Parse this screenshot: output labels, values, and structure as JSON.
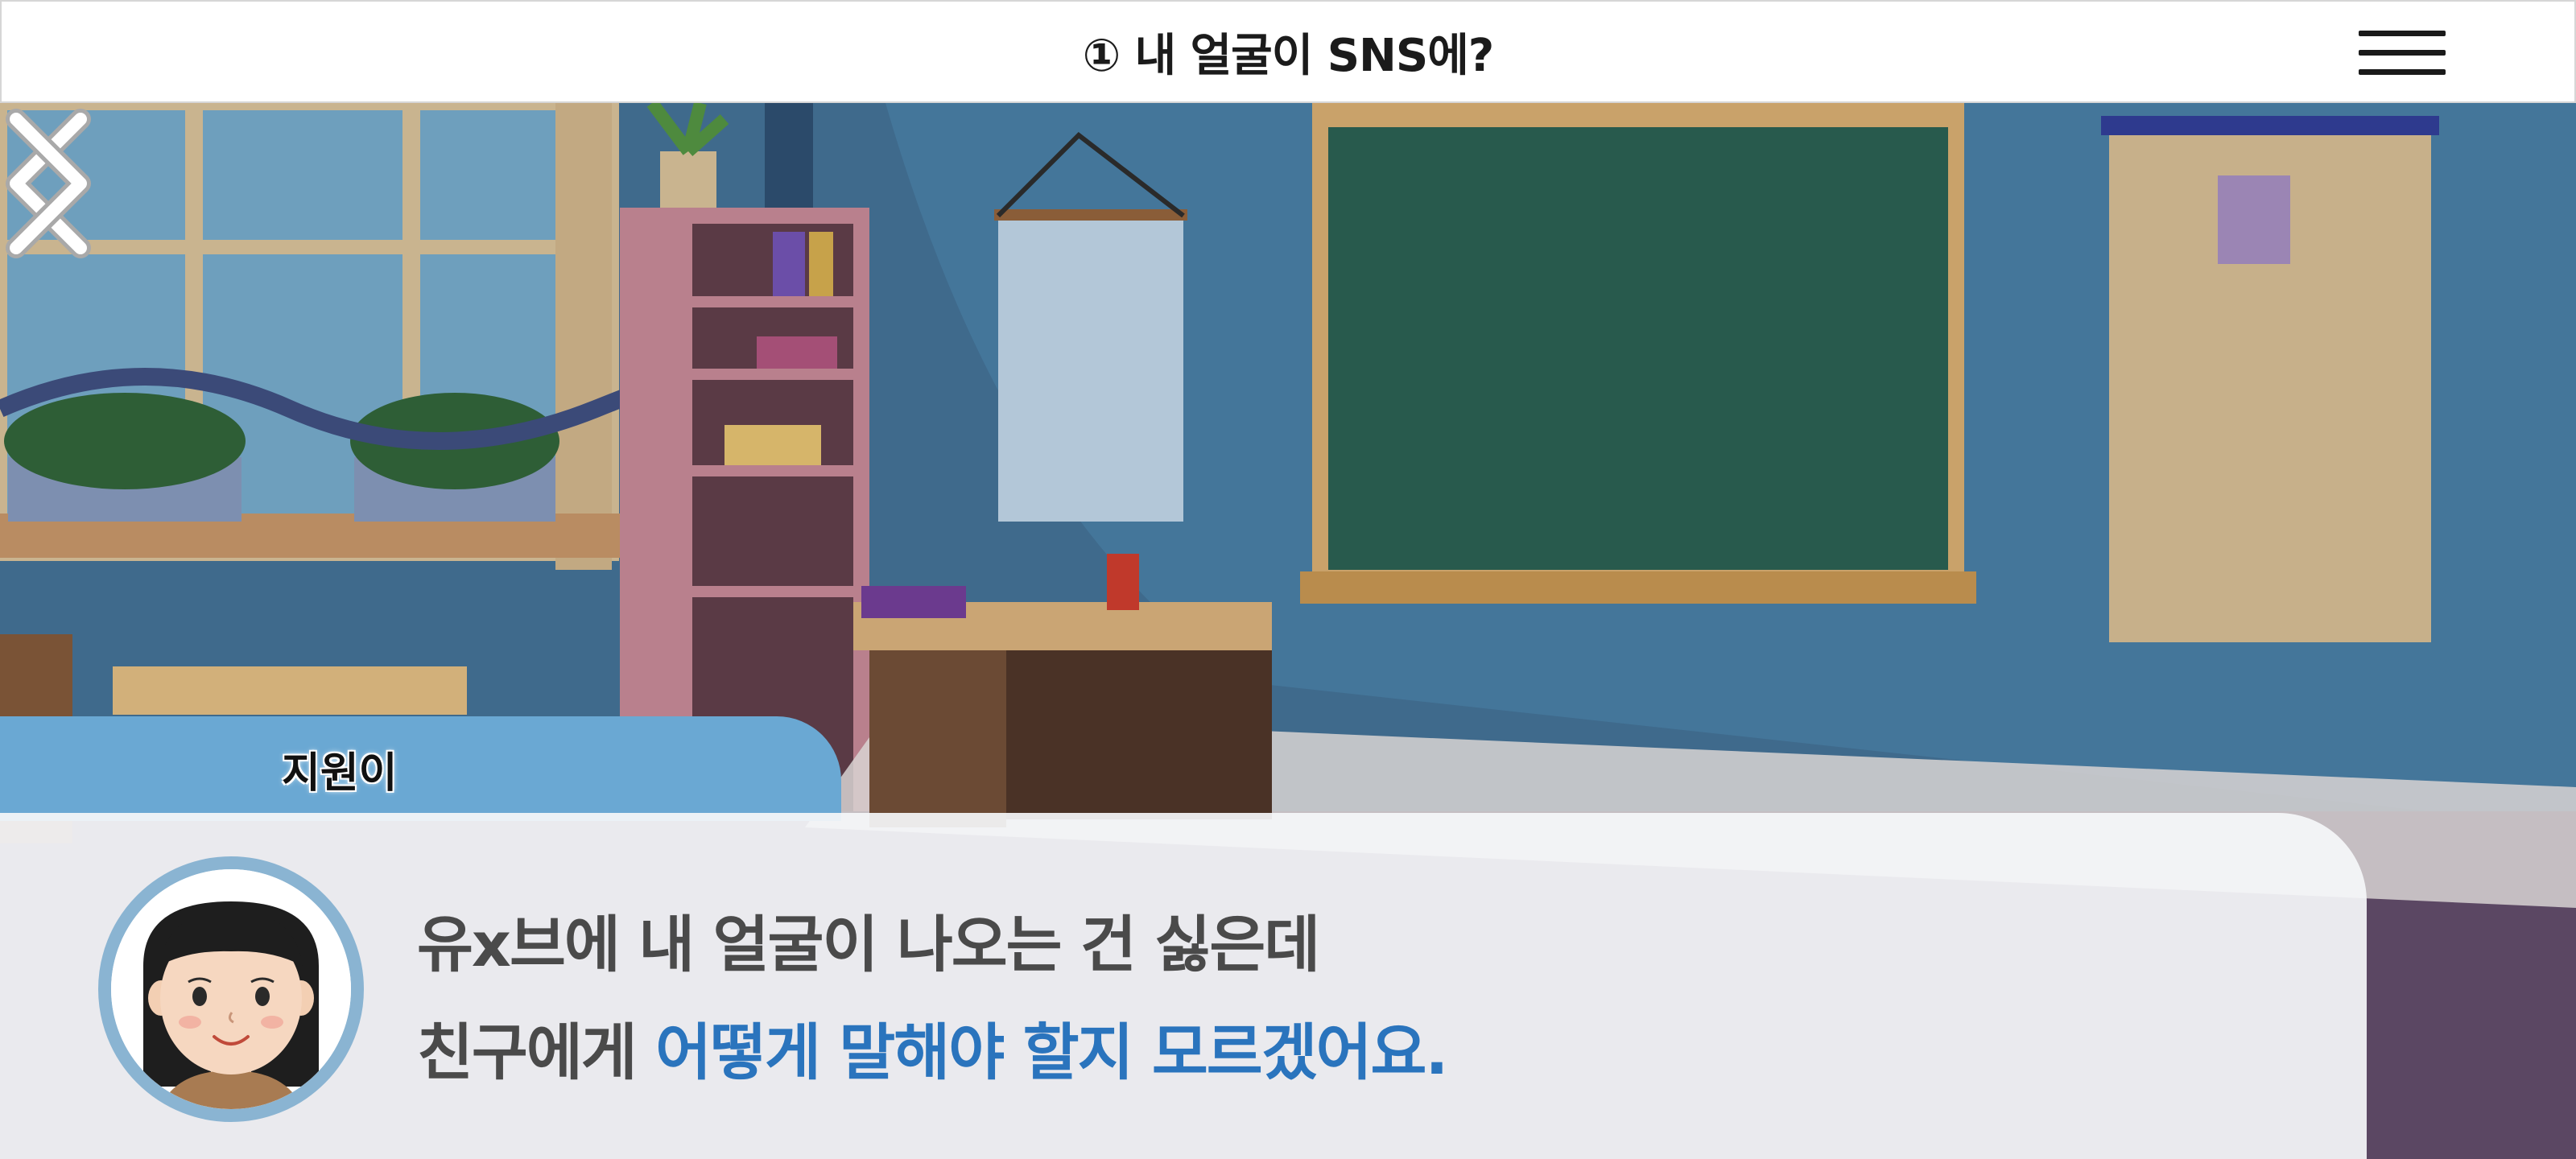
{
  "header": {
    "title": "① 내 얼굴이 SNS에?",
    "menu_icon": "hamburger-menu-icon"
  },
  "navigation": {
    "prev_icon": "chevron-left-icon",
    "next_icon": "chevron-right-icon"
  },
  "dialogue": {
    "speaker": "지원이",
    "line1": "유x브에 내 얼굴이 나오는 건 싫은데",
    "line2_plain": "친구에게 ",
    "line2_highlight": "어떻게 말해야 할지 모르겠어요.",
    "highlight_color": "#2a74bd"
  }
}
